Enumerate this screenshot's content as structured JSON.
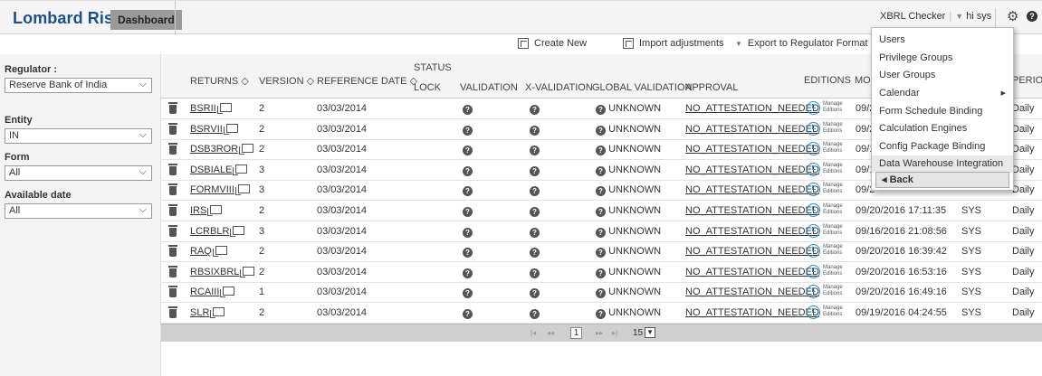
{
  "app": {
    "logo": "Lombard Risk",
    "dashboard_label": "Dashboard",
    "product": "XBRL Checker",
    "user_greeting": "hi sys"
  },
  "toolbar": {
    "create_new": "Create New",
    "import_adjustments": "Import adjustments",
    "export": "Export to Regulator Format"
  },
  "filters": {
    "regulator_label": "Regulator :",
    "regulator_value": "Reserve Bank of India",
    "entity_label": "Entity",
    "entity_value": "IN",
    "form_label": "Form",
    "form_value": "All",
    "date_label": "Available date",
    "date_value": "All"
  },
  "columns": {
    "returns": "RETURNS ◇",
    "version": "VERSION ◇",
    "reference_date": "REFERENCE DATE ◇",
    "status": "STATUS",
    "lock": "LOCK",
    "validation": "VALIDATION",
    "x_validation": "X-VALIDATION",
    "global_validation": "GLOBAL VALIDATION",
    "approval": "APPROVAL",
    "editions": "EDITIONS",
    "modified": "MO",
    "period": "PERIOI"
  },
  "manage_editions": [
    "Manage",
    "Editions"
  ],
  "rows": [
    {
      "ret": "BSRII",
      "ver": "2",
      "date": "03/03/2014",
      "gv": "UNKNOWN",
      "appr": "NO_ATTESTATION_NEEDED",
      "mod": "09/2",
      "user": "",
      "period": "Daily"
    },
    {
      "ret": "BSRVII",
      "ver": "2",
      "date": "03/03/2014",
      "gv": "UNKNOWN",
      "appr": "NO_ATTESTATION_NEEDED",
      "mod": "09/2",
      "user": "",
      "period": "Daily"
    },
    {
      "ret": "DSB3ROR",
      "ver": "2",
      "date": "03/03/2014",
      "gv": "UNKNOWN",
      "appr": "NO_ATTESTATION_NEEDED",
      "mod": "09/1",
      "user": "",
      "period": "Daily"
    },
    {
      "ret": "DSBIALE",
      "ver": "3",
      "date": "03/03/2014",
      "gv": "UNKNOWN",
      "appr": "NO_ATTESTATION_NEEDED",
      "mod": "09/1",
      "user": "",
      "period": "Daily"
    },
    {
      "ret": "FORMVIII",
      "ver": "3",
      "date": "03/03/2014",
      "gv": "UNKNOWN",
      "appr": "NO_ATTESTATION_NEEDED",
      "mod": "09/2",
      "user": "",
      "period": "Daily"
    },
    {
      "ret": "IRS",
      "ver": "2",
      "date": "03/03/2014",
      "gv": "UNKNOWN",
      "appr": "NO_ATTESTATION_NEEDED",
      "mod": "09/20/2016 17:11:35",
      "user": "SYS",
      "period": "Daily"
    },
    {
      "ret": "LCRBLR",
      "ver": "3",
      "date": "03/03/2014",
      "gv": "UNKNOWN",
      "appr": "NO_ATTESTATION_NEEDED",
      "mod": "09/16/2016 21:08:56",
      "user": "SYS",
      "period": "Daily"
    },
    {
      "ret": "RAQ",
      "ver": "2",
      "date": "03/03/2014",
      "gv": "UNKNOWN",
      "appr": "NO_ATTESTATION_NEEDED",
      "mod": "09/20/2016 16:39:42",
      "user": "SYS",
      "period": "Daily"
    },
    {
      "ret": "RBSIXBRL",
      "ver": "2",
      "date": "03/03/2014",
      "gv": "UNKNOWN",
      "appr": "NO_ATTESTATION_NEEDED",
      "mod": "09/20/2016 16:53:16",
      "user": "SYS",
      "period": "Daily"
    },
    {
      "ret": "RCAIII",
      "ver": "1",
      "date": "03/03/2014",
      "gv": "UNKNOWN",
      "appr": "NO_ATTESTATION_NEEDED",
      "mod": "09/20/2016 16:49:16",
      "user": "SYS",
      "period": "Daily"
    },
    {
      "ret": "SLR",
      "ver": "2",
      "date": "03/03/2014",
      "gv": "UNKNOWN",
      "appr": "NO_ATTESTATION_NEEDED",
      "mod": "09/19/2016 04:24:55",
      "user": "SYS",
      "period": "Daily"
    }
  ],
  "pager": {
    "first": "|◂",
    "prev": "◂◂",
    "page": "1",
    "next": "▸▸",
    "last": "▸|",
    "page_size": "15"
  },
  "menu": {
    "items": [
      {
        "label": "Users"
      },
      {
        "label": "Privilege Groups"
      },
      {
        "label": "User Groups"
      },
      {
        "label": "Calendar"
      },
      {
        "label": "Form Schedule Binding"
      },
      {
        "label": "Calculation Engines"
      },
      {
        "label": "Config Package Binding"
      },
      {
        "label": "Data Warehouse Integration"
      }
    ],
    "back": "◂ Back"
  },
  "colors": {
    "brand": "#1f4f86",
    "clock": "#2a8fd6"
  }
}
